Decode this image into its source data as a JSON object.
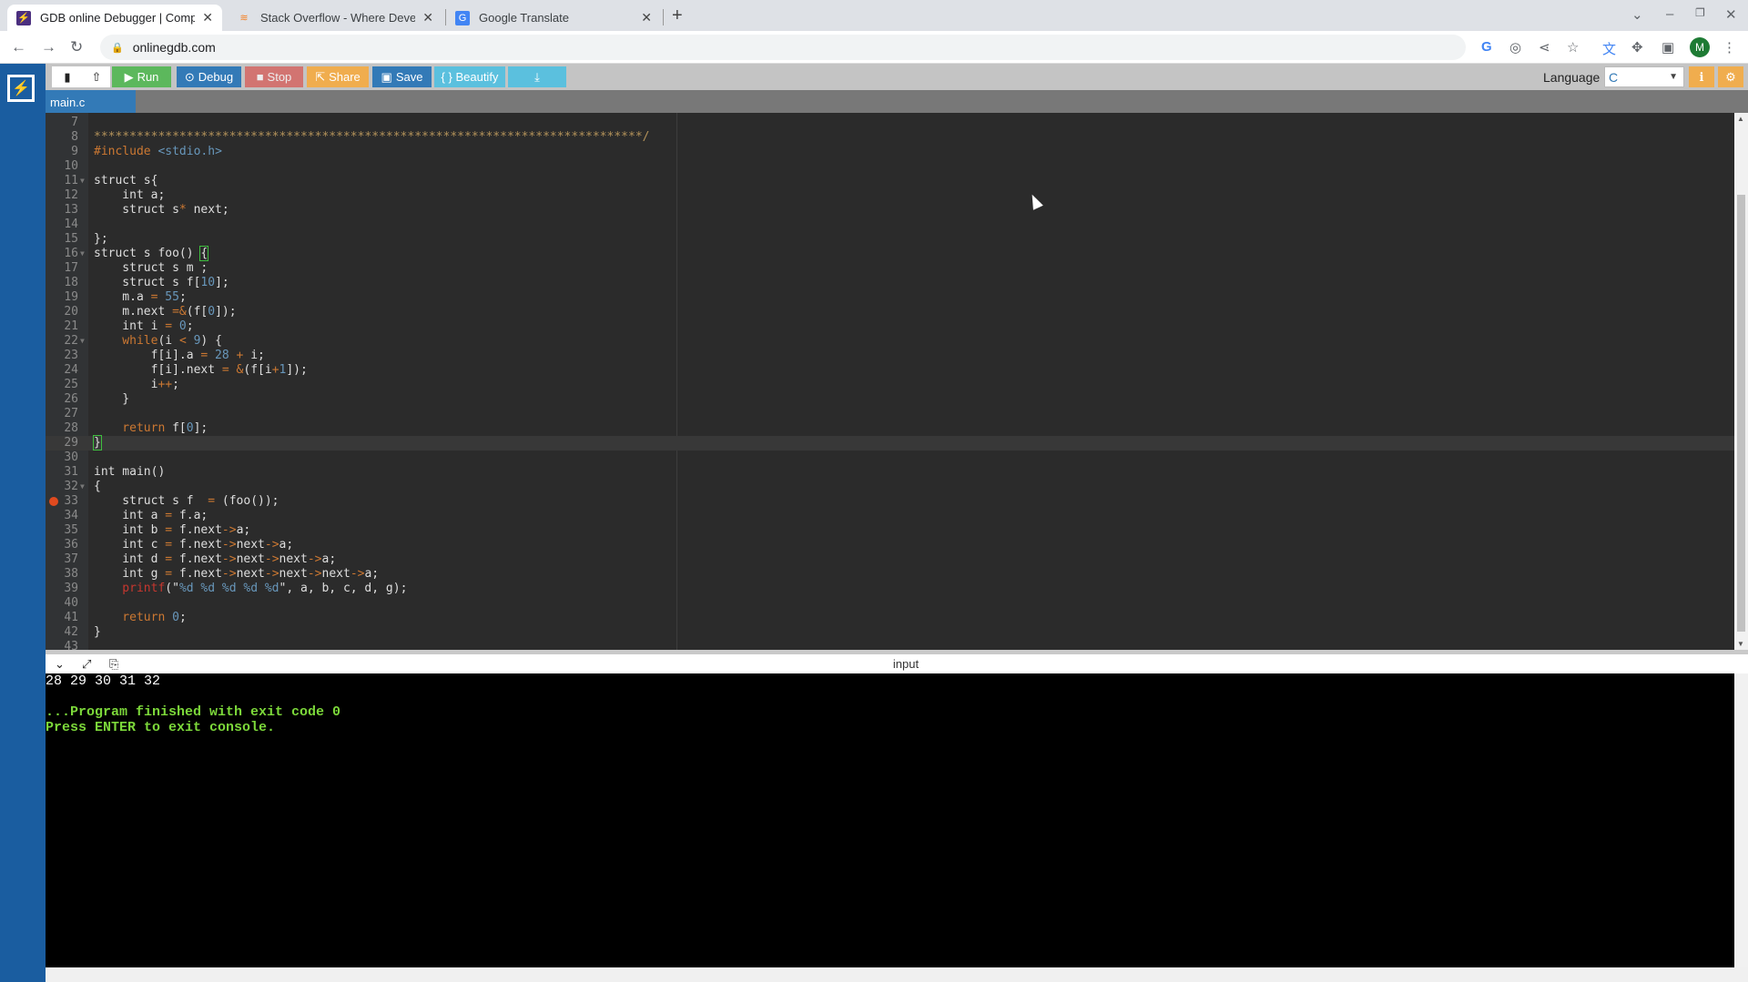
{
  "browser": {
    "tabs": [
      {
        "title": "GDB online Debugger | Compi",
        "icon": "lightning-icon",
        "active": true
      },
      {
        "title": "Stack Overflow - Where Devel",
        "icon": "stackoverflow-icon",
        "active": false
      },
      {
        "title": "Google Translate",
        "icon": "google-translate-icon",
        "active": false
      }
    ],
    "url": "onlinegdb.com",
    "avatar_letter": "M"
  },
  "toolbar": {
    "run": "Run",
    "debug": "Debug",
    "stop": "Stop",
    "share": "Share",
    "save": "Save",
    "beautify": "{ } Beautify",
    "language_label": "Language",
    "language_value": "C",
    "colors": {
      "run": "#5cb85c",
      "debug": "#337ab7",
      "stop": "#d9534f",
      "share": "#f0ad4e",
      "save": "#337ab7",
      "beautify": "#5bc0de",
      "download": "#5bc0de"
    }
  },
  "editor": {
    "file_tab": "main.c",
    "first_line": 7,
    "active_line": 29,
    "breakpoint_line": 33,
    "fold_lines": [
      11,
      16,
      22,
      32
    ],
    "lines": [
      [],
      [
        [
          "cm",
          "*****************************************************************************/"
        ]
      ],
      [
        [
          "pp",
          "#include "
        ],
        [
          "inc",
          "<stdio.h>"
        ]
      ],
      [],
      [
        [
          "",
          "struct s{"
        ]
      ],
      [
        [
          "",
          "    int a;"
        ]
      ],
      [
        [
          "",
          "    struct s"
        ],
        [
          "op",
          "*"
        ],
        [
          "",
          " next;"
        ]
      ],
      [],
      [
        [
          "",
          "};"
        ]
      ],
      [
        [
          "",
          "struct s foo() "
        ],
        [
          "br",
          "{"
        ]
      ],
      [
        [
          "",
          "    struct s m ;"
        ]
      ],
      [
        [
          "",
          "    struct s f["
        ],
        [
          "num",
          "10"
        ],
        [
          "",
          "];"
        ]
      ],
      [
        [
          "",
          "    m.a "
        ],
        [
          "op",
          "="
        ],
        [
          "num",
          " 55"
        ],
        [
          "",
          ";"
        ]
      ],
      [
        [
          "",
          "    m.next "
        ],
        [
          "op",
          "=&"
        ],
        [
          "",
          "(f["
        ],
        [
          "num",
          "0"
        ],
        [
          "",
          "]);"
        ]
      ],
      [
        [
          "",
          "    int i "
        ],
        [
          "op",
          "="
        ],
        [
          "num",
          " 0"
        ],
        [
          "",
          ";"
        ]
      ],
      [
        [
          "kw",
          "    while"
        ],
        [
          "",
          "(i "
        ],
        [
          "op",
          "<"
        ],
        [
          "num",
          " 9"
        ],
        [
          "",
          ") {"
        ]
      ],
      [
        [
          "",
          "        f[i].a "
        ],
        [
          "op",
          "="
        ],
        [
          "num",
          " 28"
        ],
        [
          "op",
          " +"
        ],
        [
          "",
          " i;"
        ]
      ],
      [
        [
          "",
          "        f[i].next "
        ],
        [
          "op",
          "="
        ],
        [
          "op",
          " &"
        ],
        [
          "",
          "(f[i"
        ],
        [
          "op",
          "+"
        ],
        [
          "num",
          "1"
        ],
        [
          "",
          "]);"
        ]
      ],
      [
        [
          "",
          "        i"
        ],
        [
          "op",
          "++"
        ],
        [
          "",
          ";"
        ]
      ],
      [
        [
          "",
          "    }"
        ]
      ],
      [],
      [
        [
          "kw",
          "    return"
        ],
        [
          "",
          " f["
        ],
        [
          "num",
          "0"
        ],
        [
          "",
          "];"
        ]
      ],
      [
        [
          "br",
          "}"
        ]
      ],
      [],
      [
        [
          "",
          "int main()"
        ]
      ],
      [
        [
          "",
          "{"
        ]
      ],
      [
        [
          "",
          "    struct s f  "
        ],
        [
          "op",
          "="
        ],
        [
          "",
          " (foo());"
        ]
      ],
      [
        [
          "",
          "    int a "
        ],
        [
          "op",
          "="
        ],
        [
          "",
          " f.a;"
        ]
      ],
      [
        [
          "",
          "    int b "
        ],
        [
          "op",
          "="
        ],
        [
          "",
          " f.next"
        ],
        [
          "op",
          "->"
        ],
        [
          "",
          "a;"
        ]
      ],
      [
        [
          "",
          "    int c "
        ],
        [
          "op",
          "="
        ],
        [
          "",
          " f.next"
        ],
        [
          "op",
          "->"
        ],
        [
          "",
          "next"
        ],
        [
          "op",
          "->"
        ],
        [
          "",
          "a;"
        ]
      ],
      [
        [
          "",
          "    int d "
        ],
        [
          "op",
          "="
        ],
        [
          "",
          " f.next"
        ],
        [
          "op",
          "->"
        ],
        [
          "",
          "next"
        ],
        [
          "op",
          "->"
        ],
        [
          "",
          "next"
        ],
        [
          "op",
          "->"
        ],
        [
          "",
          "a;"
        ]
      ],
      [
        [
          "",
          "    int g "
        ],
        [
          "op",
          "="
        ],
        [
          "",
          " f.next"
        ],
        [
          "op",
          "->"
        ],
        [
          "",
          "next"
        ],
        [
          "op",
          "->"
        ],
        [
          "",
          "next"
        ],
        [
          "op",
          "->"
        ],
        [
          "",
          "next"
        ],
        [
          "op",
          "->"
        ],
        [
          "",
          "a;"
        ]
      ],
      [
        [
          "fn",
          "    printf"
        ],
        [
          "",
          "(\""
        ],
        [
          "str",
          "%d %d %d %d %d"
        ],
        [
          "",
          "\", a, b, c, d, g);"
        ]
      ],
      [],
      [
        [
          "kw",
          "    return"
        ],
        [
          "num",
          " 0"
        ],
        [
          "",
          ";"
        ]
      ],
      [
        [
          "",
          "}"
        ]
      ],
      []
    ]
  },
  "console": {
    "header_label": "input",
    "output": "28 29 30 31 32",
    "finished": "...Program finished with exit code 0",
    "press_enter": "Press ENTER to exit console."
  }
}
